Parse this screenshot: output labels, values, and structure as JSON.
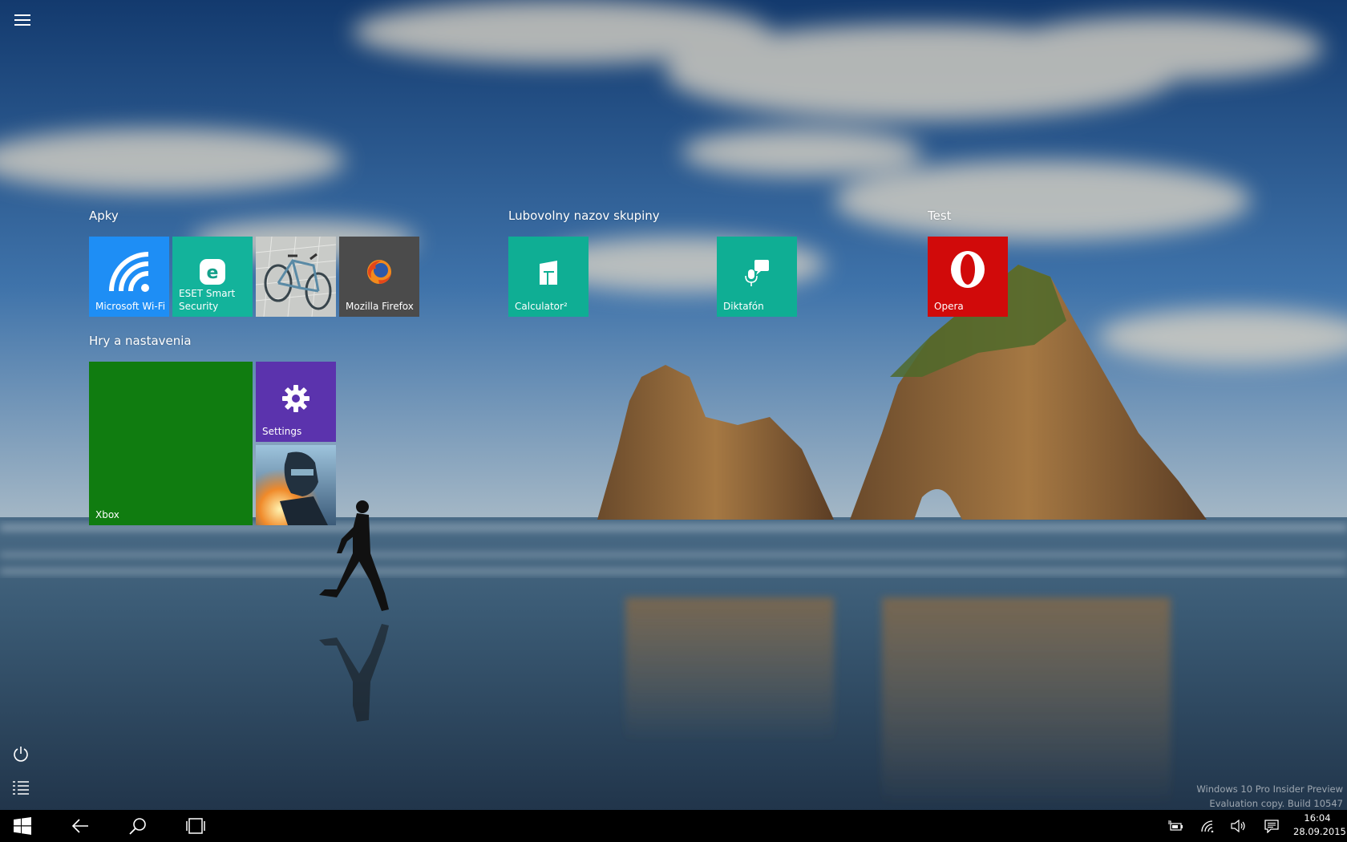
{
  "groups": [
    {
      "title": "Apky"
    },
    {
      "title": "Lubovolny nazov skupiny"
    },
    {
      "title": "Test"
    },
    {
      "title": "Hry a nastavenia"
    }
  ],
  "tiles": {
    "wifi": {
      "label": "Microsoft Wi-Fi",
      "color": "#1e8ef5"
    },
    "eset": {
      "label": "ESET Smart Security",
      "color": "#13b39b"
    },
    "photo": {
      "label": ""
    },
    "firefox": {
      "label": "Mozilla Firefox",
      "color": "#4b4b4b"
    },
    "calculator": {
      "label": "Calculator²",
      "color": "#0fae94"
    },
    "diktafon": {
      "label": "Diktafón",
      "color": "#0fae94"
    },
    "opera": {
      "label": "Opera",
      "color": "#d10a0a"
    },
    "xbox": {
      "label": "Xbox",
      "color": "#107c10"
    },
    "settings": {
      "label": "Settings",
      "color": "#5b33ad"
    },
    "game": {
      "label": ""
    }
  },
  "watermark": {
    "line1": "Windows 10 Pro Insider Preview",
    "line2": "Evaluation copy. Build 10547"
  },
  "clock": {
    "time": "16:04",
    "date": "28.09.2015"
  },
  "icons": {
    "menu": "hamburger-icon",
    "power": "power-icon",
    "all_apps": "list-icon",
    "start": "windows-logo-icon",
    "back": "back-arrow-icon",
    "search": "search-icon",
    "task_view": "task-view-icon",
    "battery": "battery-icon",
    "network": "network-icon",
    "volume": "volume-icon",
    "notifications": "action-center-icon"
  }
}
